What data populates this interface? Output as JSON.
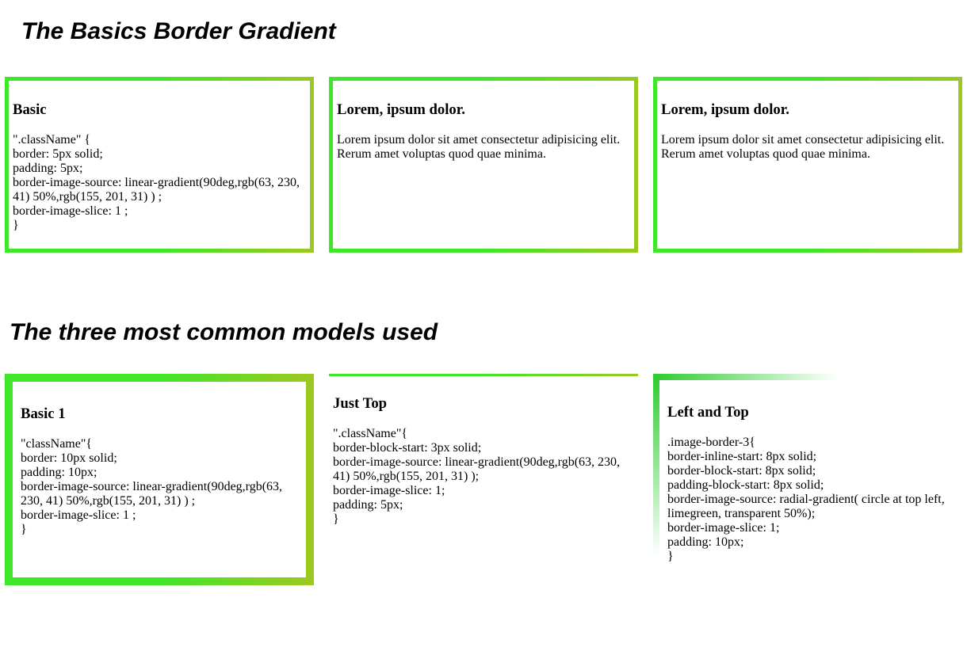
{
  "headings": {
    "basics": "The Basics Border Gradient",
    "models": "The three most common models used"
  },
  "row1": {
    "basic": {
      "title": "Basic",
      "code": [
        "\".className\" {",
        "border: 5px solid;",
        "padding: 5px;",
        "border-image-source: linear-gradient(90deg,rgb(63, 230, 41) 50%,rgb(155, 201, 31) ) ;",
        "border-image-slice: 1 ;",
        "}"
      ]
    },
    "lorem1": {
      "title": "Lorem, ipsum dolor.",
      "text": "Lorem ipsum dolor sit amet consectetur adipisicing elit. Rerum amet voluptas quod quae minima."
    },
    "lorem2": {
      "title": "Lorem, ipsum dolor.",
      "text": "Lorem ipsum dolor sit amet consectetur adipisicing elit. Rerum amet voluptas quod quae minima."
    }
  },
  "row2": {
    "basic1": {
      "title": "Basic 1",
      "code": [
        "\"className\"{",
        "border: 10px solid;",
        "padding: 10px;",
        "border-image-source: linear-gradient(90deg,rgb(63, 230, 41) 50%,rgb(155, 201, 31) ) ;",
        "border-image-slice: 1 ;",
        "}"
      ]
    },
    "justtop": {
      "title": "Just Top",
      "code": [
        "\".className\"{",
        "border-block-start: 3px solid;",
        "border-image-source: linear-gradient(90deg,rgb(63, 230, 41) 50%,rgb(155, 201, 31) );",
        "border-image-slice: 1;",
        "padding: 5px;",
        "}"
      ]
    },
    "lefttop": {
      "title": "Left and Top",
      "code": [
        ".image-border-3{",
        "border-inline-start: 8px solid;",
        "border-block-start: 8px solid;",
        "padding-block-start: 8px solid;",
        "border-image-source: radial-gradient( circle at top left, limegreen, transparent 50%);",
        "border-image-slice: 1;",
        "padding: 10px;",
        "}"
      ]
    }
  },
  "colors": {
    "gradient_start": "#3fe629",
    "gradient_end": "#9bc91f",
    "radial": "limegreen"
  }
}
